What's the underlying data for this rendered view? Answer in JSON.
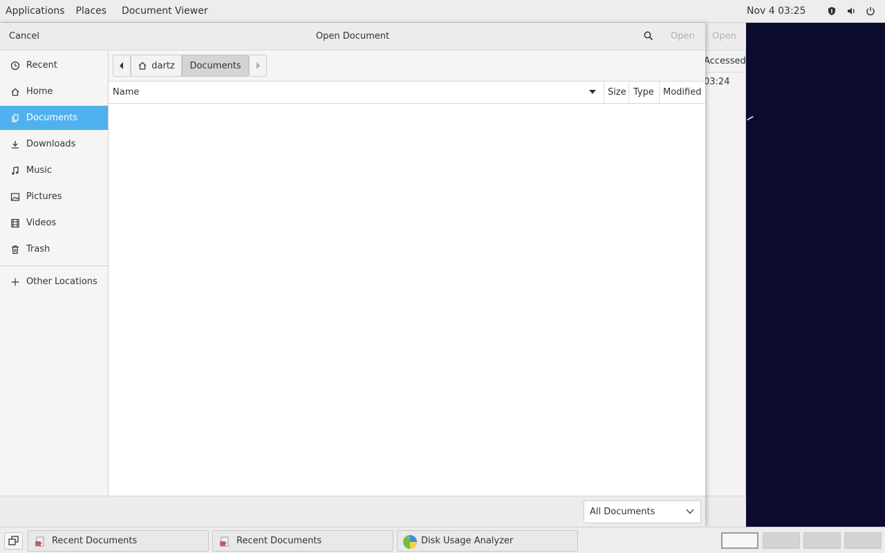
{
  "topbar": {
    "menus": [
      "Applications",
      "Places",
      "Document Viewer"
    ],
    "clock": "Nov 4  03:25",
    "tray_icons": [
      "shield-icon",
      "volume-icon",
      "power-icon"
    ]
  },
  "background_window": {
    "open_label": "Open",
    "column_header": "Accessed",
    "time_value": "03:24"
  },
  "dialog": {
    "cancel_label": "Cancel",
    "title": "Open Document",
    "open_label": "Open",
    "sidebar": {
      "items": [
        {
          "label": "Recent",
          "icon": "clock-icon"
        },
        {
          "label": "Home",
          "icon": "home-icon"
        },
        {
          "label": "Documents",
          "icon": "documents-icon",
          "active": true
        },
        {
          "label": "Downloads",
          "icon": "download-icon"
        },
        {
          "label": "Music",
          "icon": "music-icon"
        },
        {
          "label": "Pictures",
          "icon": "pictures-icon"
        },
        {
          "label": "Videos",
          "icon": "videos-icon"
        },
        {
          "label": "Trash",
          "icon": "trash-icon"
        }
      ],
      "other_locations": "Other Locations"
    },
    "pathbar": {
      "home_label": "dartz",
      "current_label": "Documents"
    },
    "columns": {
      "name": "Name",
      "size": "Size",
      "type": "Type",
      "modified": "Modified"
    },
    "filter": {
      "selected": "All Documents"
    }
  },
  "taskbar": {
    "tasks": [
      {
        "label": "Recent Documents"
      },
      {
        "label": "Recent Documents"
      },
      {
        "label": "Disk Usage Analyzer"
      }
    ]
  },
  "colors": {
    "accent": "#4fb1ee",
    "desktop": "#0b0b2e"
  }
}
